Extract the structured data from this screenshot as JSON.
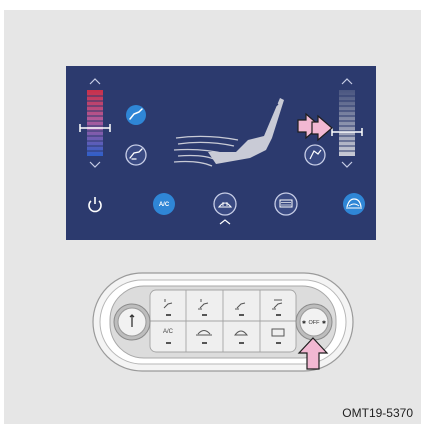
{
  "figure": {
    "code": "OMT19-5370"
  },
  "screen": {
    "bottom_buttons": [
      {
        "name": "power",
        "icon": "power-icon",
        "label": "",
        "active": false
      },
      {
        "name": "ac",
        "icon": "",
        "label": "A/C",
        "active": true
      },
      {
        "name": "front-defrost",
        "icon": "front-defrost-icon",
        "label": "",
        "active": false
      },
      {
        "name": "rear-defrost",
        "icon": "rear-defrost-icon",
        "label": "",
        "active": false
      },
      {
        "name": "recirculation",
        "icon": "recirculation-icon",
        "label": "",
        "active": true
      }
    ],
    "left_mode_buttons": [
      {
        "name": "face-mode",
        "icon": "face-mode-icon",
        "active": true
      },
      {
        "name": "floor-mode",
        "icon": "floor-mode-icon",
        "active": false
      }
    ],
    "right_mode_button": {
      "name": "auto-fan",
      "icon": "fan-auto-icon",
      "active": false
    },
    "colors": {
      "screen_bg": "#2c3a6e",
      "active_button": "#2f86d6",
      "temp_hot": "#c8304a",
      "temp_cold": "#2f5fc8",
      "arrow_pointer": "#f2b8d2"
    }
  },
  "panel": {
    "left_knob": {
      "icon": "temperature-icon"
    },
    "right_knob": {
      "left_symbol": "✱",
      "label": "OFF",
      "right_symbol": "✱"
    },
    "top_row": [
      {
        "icon": "face-mode-icon"
      },
      {
        "icon": "face-floor-mode-icon"
      },
      {
        "icon": "floor-mode-icon"
      },
      {
        "icon": "floor-defrost-mode-icon"
      }
    ],
    "bottom_row": [
      {
        "label": "A/C"
      },
      {
        "icon": "recirculation-icon",
        "label": ""
      },
      {
        "icon": "front-defrost-icon",
        "label": ""
      },
      {
        "icon": "rear-defrost-icon",
        "label": ""
      }
    ]
  }
}
